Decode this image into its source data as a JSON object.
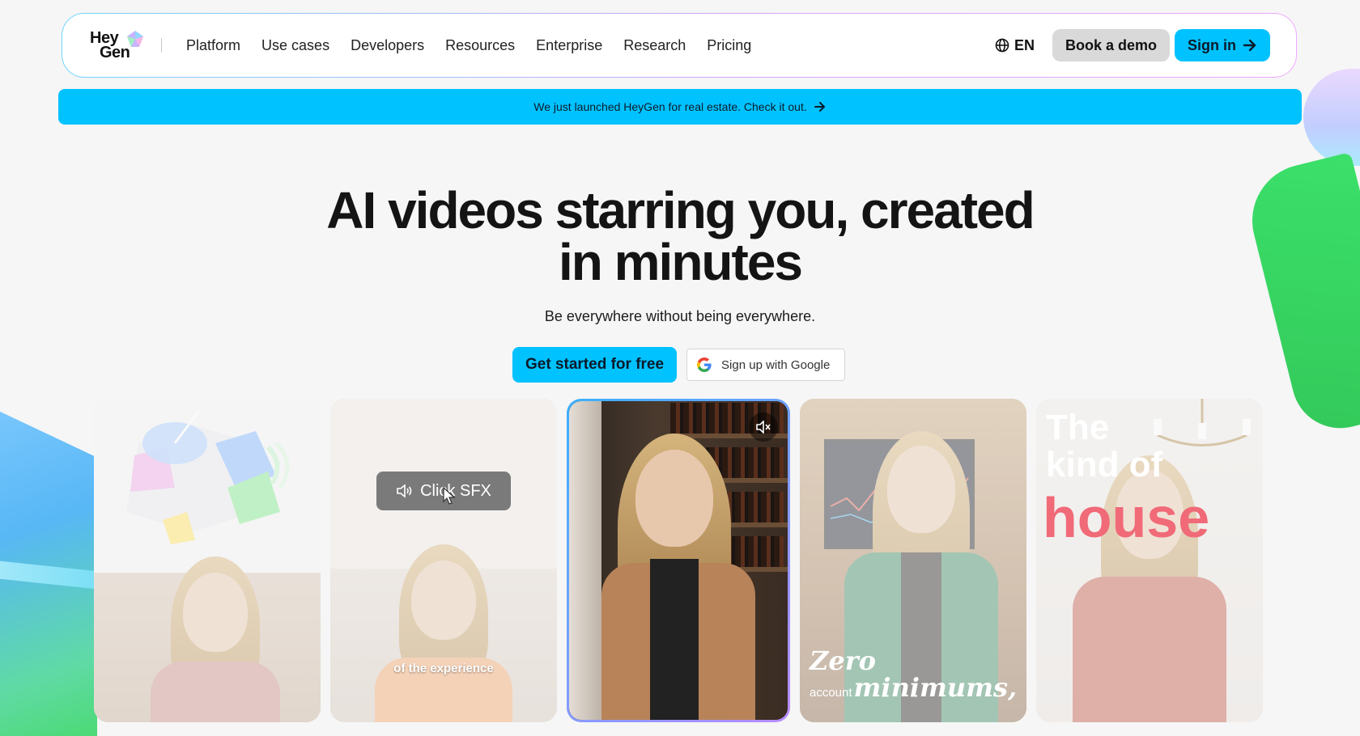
{
  "brand": {
    "logo_line1": "Hey",
    "logo_line2": "Gen",
    "accent": "#00c2ff"
  },
  "nav": {
    "items": [
      "Platform",
      "Use cases",
      "Developers",
      "Resources",
      "Enterprise",
      "Research",
      "Pricing"
    ],
    "language": "EN",
    "book_demo": "Book a demo",
    "sign_in": "Sign in"
  },
  "banner": {
    "text": "We just launched HeyGen for real estate. Check it out."
  },
  "hero": {
    "title_line1": "AI videos starring you, created",
    "title_line2": "in minutes",
    "subtitle": "Be everywhere without being everywhere.",
    "cta_primary": "Get started for free",
    "cta_google": "Sign up with Google"
  },
  "cards": {
    "card2_pill": "Click SFX",
    "card2_caption": "of the experience",
    "card4_line1": "Zero",
    "card4_line2_small": "account",
    "card4_line2": "minimums,",
    "card5_line1": "The",
    "card5_line2": "kind of",
    "card5_line3": "house"
  }
}
